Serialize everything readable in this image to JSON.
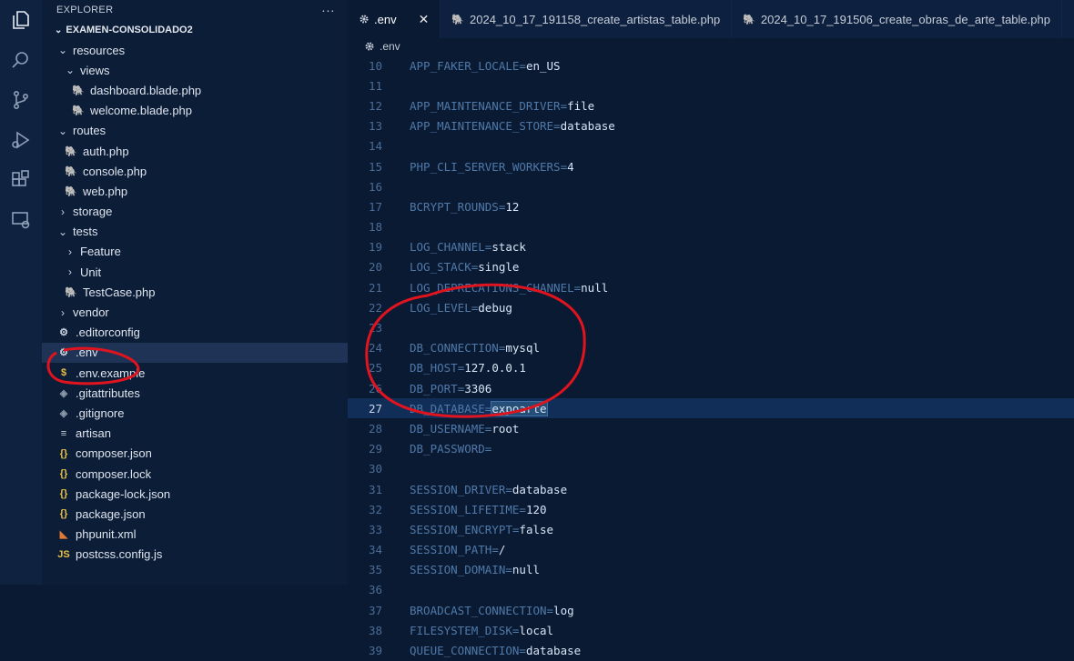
{
  "sidebar": {
    "title": "EXPLORER",
    "more": "···",
    "project": "EXAMEN-CONSOLIDADO2",
    "items": [
      {
        "label": "resources",
        "type": "folder-open",
        "depth": 1
      },
      {
        "label": "views",
        "type": "folder-open",
        "depth": 2
      },
      {
        "label": "dashboard.blade.php",
        "type": "php",
        "depth": 3
      },
      {
        "label": "welcome.blade.php",
        "type": "php",
        "depth": 3
      },
      {
        "label": "routes",
        "type": "folder-open",
        "depth": 1
      },
      {
        "label": "auth.php",
        "type": "php",
        "depth": 2
      },
      {
        "label": "console.php",
        "type": "php",
        "depth": 2
      },
      {
        "label": "web.php",
        "type": "php",
        "depth": 2
      },
      {
        "label": "storage",
        "type": "folder-closed",
        "depth": 1
      },
      {
        "label": "tests",
        "type": "folder-open",
        "depth": 1
      },
      {
        "label": "Feature",
        "type": "folder-closed",
        "depth": 2
      },
      {
        "label": "Unit",
        "type": "folder-closed",
        "depth": 2
      },
      {
        "label": "TestCase.php",
        "type": "php",
        "depth": 2
      },
      {
        "label": "vendor",
        "type": "folder-closed",
        "depth": 1
      },
      {
        "label": ".editorconfig",
        "type": "gear",
        "depth": 1
      },
      {
        "label": ".env",
        "type": "gear",
        "depth": 1
      },
      {
        "label": ".env.example",
        "type": "dollar",
        "depth": 1
      },
      {
        "label": ".gitattributes",
        "type": "git",
        "depth": 1
      },
      {
        "label": ".gitignore",
        "type": "git",
        "depth": 1
      },
      {
        "label": "artisan",
        "type": "lines",
        "depth": 1
      },
      {
        "label": "composer.json",
        "type": "json",
        "depth": 1
      },
      {
        "label": "composer.lock",
        "type": "json",
        "depth": 1
      },
      {
        "label": "package-lock.json",
        "type": "json",
        "depth": 1
      },
      {
        "label": "package.json",
        "type": "json",
        "depth": 1
      },
      {
        "label": "phpunit.xml",
        "type": "rss",
        "depth": 1
      },
      {
        "label": "postcss.config.js",
        "type": "js",
        "depth": 1
      }
    ]
  },
  "tabs": [
    {
      "label": ".env",
      "icon": "gear",
      "active": true,
      "close": "✕"
    },
    {
      "label": "2024_10_17_191158_create_artistas_table.php",
      "icon": "php",
      "active": false
    },
    {
      "label": "2024_10_17_191506_create_obras_de_arte_table.php",
      "icon": "php",
      "active": false
    }
  ],
  "breadcrumb": ".env",
  "code": [
    {
      "n": "10",
      "k": "APP_FAKER_LOCALE",
      "v": "en_US"
    },
    {
      "n": "11",
      "k": "",
      "v": ""
    },
    {
      "n": "12",
      "k": "APP_MAINTENANCE_DRIVER",
      "v": "file"
    },
    {
      "n": "13",
      "k": "APP_MAINTENANCE_STORE",
      "v": "database"
    },
    {
      "n": "14",
      "k": "",
      "v": ""
    },
    {
      "n": "15",
      "k": "PHP_CLI_SERVER_WORKERS",
      "v": "4"
    },
    {
      "n": "16",
      "k": "",
      "v": ""
    },
    {
      "n": "17",
      "k": "BCRYPT_ROUNDS",
      "v": "12"
    },
    {
      "n": "18",
      "k": "",
      "v": ""
    },
    {
      "n": "19",
      "k": "LOG_CHANNEL",
      "v": "stack"
    },
    {
      "n": "20",
      "k": "LOG_STACK",
      "v": "single"
    },
    {
      "n": "21",
      "k": "LOG_DEPRECATIONS_CHANNEL",
      "v": "null"
    },
    {
      "n": "22",
      "k": "LOG_LEVEL",
      "v": "debug"
    },
    {
      "n": "23",
      "k": "",
      "v": ""
    },
    {
      "n": "24",
      "k": "DB_CONNECTION",
      "v": "mysql"
    },
    {
      "n": "25",
      "k": "DB_HOST",
      "v": "127.0.0.1"
    },
    {
      "n": "26",
      "k": "DB_PORT",
      "v": "3306"
    },
    {
      "n": "27",
      "k": "DB_DATABASE",
      "v": "expoarte",
      "current": true
    },
    {
      "n": "28",
      "k": "DB_USERNAME",
      "v": "root"
    },
    {
      "n": "29",
      "k": "DB_PASSWORD",
      "v": ""
    },
    {
      "n": "30",
      "k": "",
      "v": ""
    },
    {
      "n": "31",
      "k": "SESSION_DRIVER",
      "v": "database"
    },
    {
      "n": "32",
      "k": "SESSION_LIFETIME",
      "v": "120"
    },
    {
      "n": "33",
      "k": "SESSION_ENCRYPT",
      "v": "false"
    },
    {
      "n": "34",
      "k": "SESSION_PATH",
      "v": "/"
    },
    {
      "n": "35",
      "k": "SESSION_DOMAIN",
      "v": "null"
    },
    {
      "n": "36",
      "k": "",
      "v": ""
    },
    {
      "n": "37",
      "k": "BROADCAST_CONNECTION",
      "v": "log"
    },
    {
      "n": "38",
      "k": "FILESYSTEM_DISK",
      "v": "local"
    },
    {
      "n": "39",
      "k": "QUEUE_CONNECTION",
      "v": "database"
    }
  ],
  "colors": {
    "annotation": "#e0141e",
    "php_icon": "#a074c4",
    "json_icon": "#e8c043",
    "js_icon": "#e8c043",
    "rss_icon": "#e37933"
  }
}
